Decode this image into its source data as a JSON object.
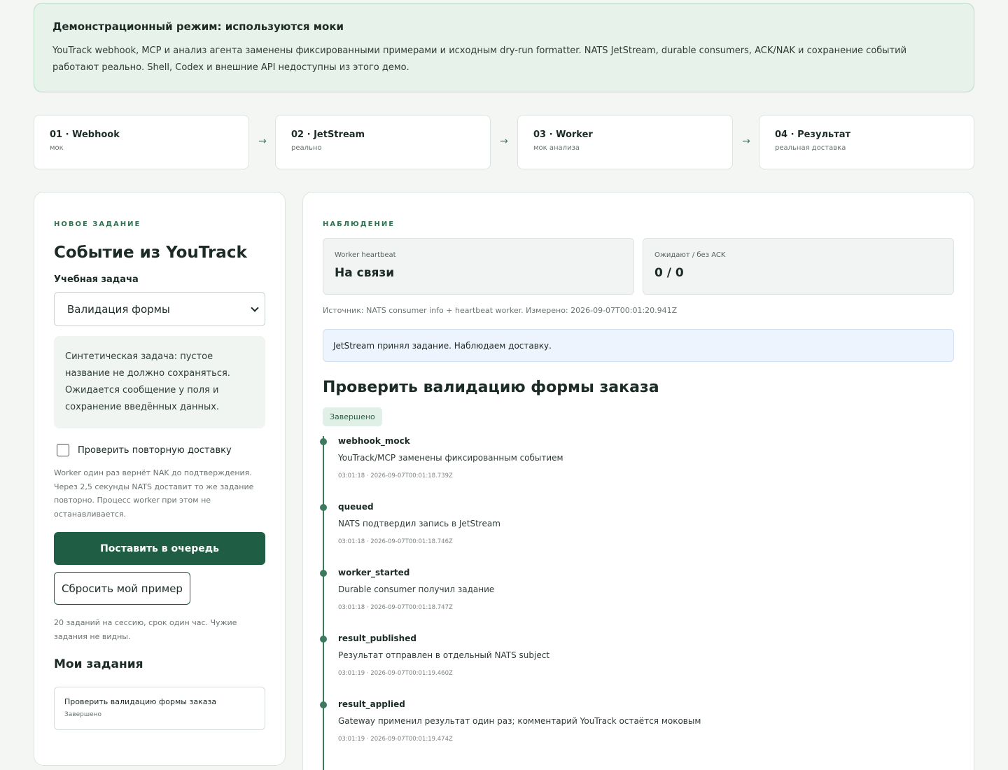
{
  "banner": {
    "title": "Демонстрационный режим: используются моки",
    "text": "YouTrack webhook, MCP и анализ агента заменены фиксированными примерами и исходным dry-run formatter. NATS JetStream, durable consumers, ACK/NAK и сохранение событий работают реально. Shell, Codex и внешние API недоступны из этого демо."
  },
  "steps": [
    {
      "title": "01 · Webhook",
      "sub": "мок"
    },
    {
      "title": "02 · JetStream",
      "sub": "реально"
    },
    {
      "title": "03 · Worker",
      "sub": "мок анализа"
    },
    {
      "title": "04 · Результат",
      "sub": "реальная доставка"
    }
  ],
  "step_arrow": "→",
  "left": {
    "eyebrow": "Новое задание",
    "title": "Событие из YouTrack",
    "task_label": "Учебная задача",
    "task_select_value": "Валидация формы",
    "description": "Синтетическая задача: пустое название не должно сохраняться. Ожидается сообщение у поля и сохранение введённых данных.",
    "redelivery_label": "Проверить повторную доставку",
    "redelivery_checked": false,
    "redelivery_hint": "Worker один раз вернёт NAK до подтверждения. Через 2,5 секунды NATS доставит то же задание повторно. Процесс worker при этом не останавливается.",
    "enqueue_button": "Поставить в очередь",
    "reset_button": "Сбросить мой пример",
    "session_hint": "20 заданий на сессию, срок один час. Чужие задания не видны.",
    "my_tasks_title": "Мои задания",
    "my_tasks": [
      {
        "title": "Проверить валидацию формы заказа",
        "status": "Завершено"
      }
    ]
  },
  "right": {
    "eyebrow": "Наблюдение",
    "metrics": [
      {
        "label": "Worker heartbeat",
        "value": "На связи"
      },
      {
        "label": "Ожидают / без ACK",
        "value": "0 / 0"
      }
    ],
    "source": "Источник: NATS consumer info + heartbeat worker. Измерено: 2026-09-07T00:01:20.941Z",
    "info": "JetStream принял задание. Наблюдаем доставку.",
    "job_title": "Проверить валидацию формы заказа",
    "job_status": "Завершено",
    "events": [
      {
        "name": "webhook_mock",
        "text": "YouTrack/MCP заменены фиксированным событием",
        "time": "03:01:18 · 2026-09-07T00:01:18.739Z"
      },
      {
        "name": "queued",
        "text": "NATS подтвердил запись в JetStream",
        "time": "03:01:18 · 2026-09-07T00:01:18.746Z"
      },
      {
        "name": "worker_started",
        "text": "Durable consumer получил задание",
        "time": "03:01:18 · 2026-09-07T00:01:18.747Z"
      },
      {
        "name": "result_published",
        "text": "Результат отправлен в отдельный NATS subject",
        "time": "03:01:19 · 2026-09-07T00:01:19.460Z"
      },
      {
        "name": "result_applied",
        "text": "Gateway применил результат один раз; комментарий YouTrack остаётся моковым",
        "time": "03:01:19 · 2026-09-07T00:01:19.474Z"
      }
    ]
  },
  "colors": {
    "accent": "#1f5e45",
    "timeline": "#3b7a5c",
    "banner_bg": "#e6f2ea",
    "info_bg": "#edf4fd"
  }
}
